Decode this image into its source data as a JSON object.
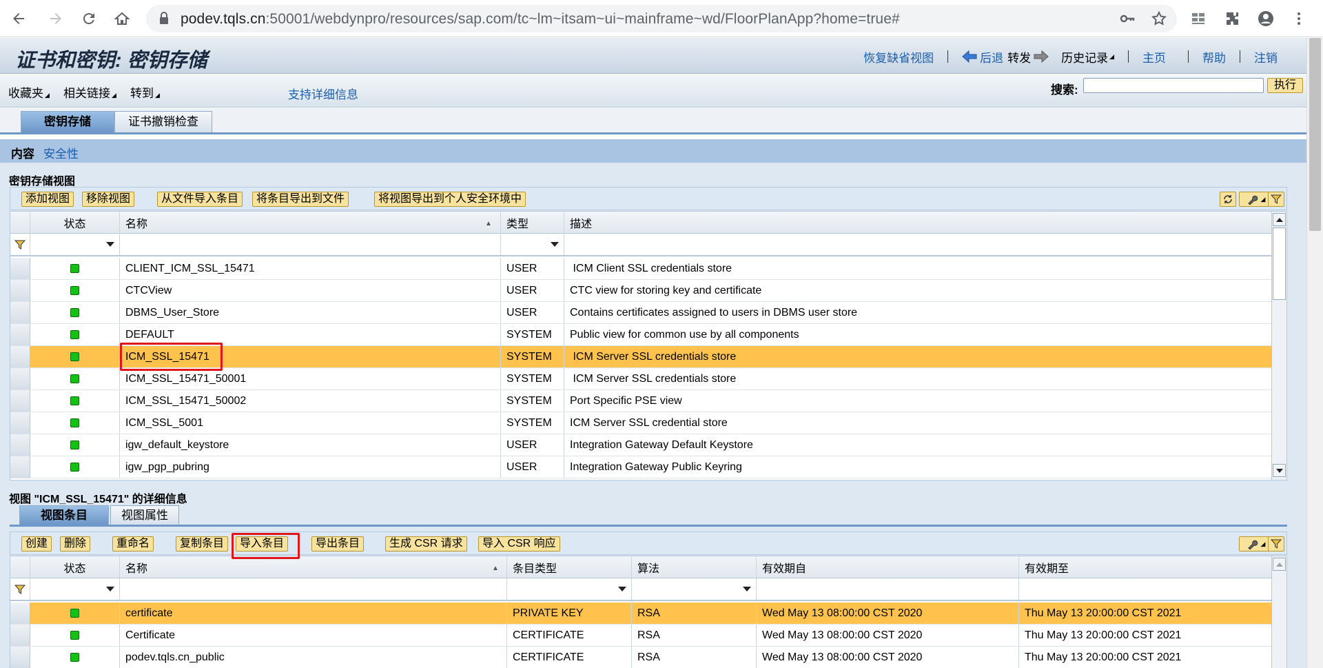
{
  "browser": {
    "url_host": "podev.tqls.cn",
    "url_rest": ":50001/webdynpro/resources/sap.com/tc~lm~itsam~ui~mainframe~wd/FloorPlanApp?home=true#"
  },
  "header": {
    "title": "证书和密钥: 密钥存储",
    "restore_view": "恢复缺省视图",
    "back": "后退",
    "forward": "转发",
    "history": "历史记录",
    "home": "主页",
    "help": "帮助",
    "logout": "注销"
  },
  "subbar": {
    "favorites": "收藏夹",
    "related_links": "相关链接",
    "goto": "转到",
    "support_details": "支持详细信息",
    "search_label": "搜索:",
    "search_value": "",
    "execute": "执行"
  },
  "tabs": [
    {
      "label": "密钥存储",
      "active": true
    },
    {
      "label": "证书撤销检查",
      "active": false
    }
  ],
  "content_bar": {
    "content": "内容",
    "security": "安全性"
  },
  "keystore": {
    "section_title": "密钥存储视图",
    "toolbar": {
      "add_view": "添加视图",
      "remove_view": "移除视图",
      "import_from_file": "从文件导入条目",
      "export_to_file": "将条目导出到文件",
      "export_to_pse": "将视图导出到个人安全环境中"
    },
    "columns": {
      "status": "状态",
      "name": "名称",
      "type": "类型",
      "description": "描述"
    },
    "rows": [
      {
        "name": "CLIENT_ICM_SSL_15471",
        "type": "USER",
        "desc": " ICM Client SSL credentials store",
        "selected": false
      },
      {
        "name": "CTCView",
        "type": "USER",
        "desc": "CTC view for storing key and certificate",
        "selected": false
      },
      {
        "name": "DBMS_User_Store",
        "type": "USER",
        "desc": "Contains certificates assigned to users in DBMS user store",
        "selected": false
      },
      {
        "name": "DEFAULT",
        "type": "SYSTEM",
        "desc": "Public view for common use by all components",
        "selected": false
      },
      {
        "name": "ICM_SSL_15471",
        "type": "SYSTEM",
        "desc": " ICM Server SSL credentials store",
        "selected": true
      },
      {
        "name": "ICM_SSL_15471_50001",
        "type": "SYSTEM",
        "desc": " ICM Server SSL credentials store",
        "selected": false
      },
      {
        "name": "ICM_SSL_15471_50002",
        "type": "SYSTEM",
        "desc": "Port Specific PSE view",
        "selected": false
      },
      {
        "name": "ICM_SSL_5001",
        "type": "SYSTEM",
        "desc": "ICM Server SSL credential store",
        "selected": false
      },
      {
        "name": "igw_default_keystore",
        "type": "USER",
        "desc": "Integration Gateway Default Keystore",
        "selected": false
      },
      {
        "name": "igw_pgp_pubring",
        "type": "USER",
        "desc": "Integration Gateway Public Keyring",
        "selected": false
      }
    ]
  },
  "details": {
    "section_title": "视图 \"ICM_SSL_15471\" 的详细信息",
    "tabs": [
      {
        "label": "视图条目",
        "active": true
      },
      {
        "label": "视图属性",
        "active": false
      }
    ],
    "toolbar": {
      "create": "创建",
      "delete": "删除",
      "rename": "重命名",
      "copy_entry": "复制条目",
      "import_entry": "导入条目",
      "export_entry": "导出条目",
      "create_csr": "生成 CSR 请求",
      "import_csr": "导入 CSR 响应"
    },
    "columns": {
      "status": "状态",
      "name": "名称",
      "entry_type": "条目类型",
      "algorithm": "算法",
      "valid_from": "有效期自",
      "valid_to": "有效期至"
    },
    "rows": [
      {
        "name": "certificate",
        "type": "PRIVATE KEY",
        "alg": "RSA",
        "from": "Wed May 13 08:00:00 CST 2020",
        "to": "Thu May 13 20:00:00 CST 2021",
        "selected": true
      },
      {
        "name": "Certificate",
        "type": "CERTIFICATE",
        "alg": "RSA",
        "from": "Wed May 13 08:00:00 CST 2020",
        "to": "Thu May 13 20:00:00 CST 2021",
        "selected": false
      },
      {
        "name": "podev.tqls.cn_public",
        "type": "CERTIFICATE",
        "alg": "RSA",
        "from": "Wed May 13 08:00:00 CST 2020",
        "to": "Thu May 13 20:00:00 CST 2021",
        "selected": false
      }
    ]
  },
  "colors": {
    "accent": "#1c5eac",
    "selected_row": "#ffc34d",
    "button": "#f7e39d",
    "highlight_box": "#e0161c",
    "status_ok": "#13c213"
  }
}
